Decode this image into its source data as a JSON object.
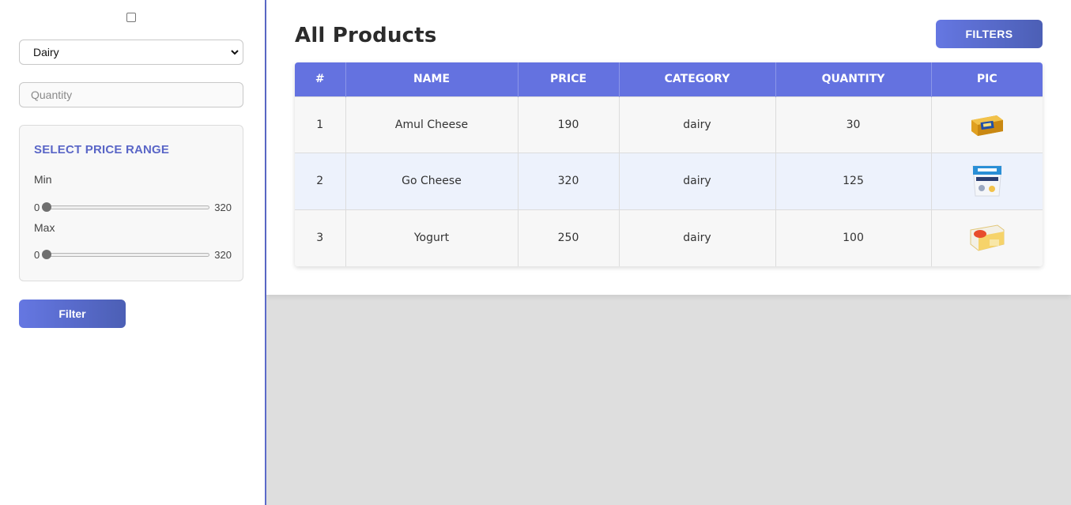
{
  "sidebar": {
    "category_select": {
      "value": "Dairy"
    },
    "quantity": {
      "placeholder": "Quantity"
    },
    "price_range": {
      "title": "SELECT PRICE RANGE",
      "min": {
        "label": "Min",
        "low": "0",
        "high": "320",
        "value": 0
      },
      "max": {
        "label": "Max",
        "low": "0",
        "high": "320",
        "value": 0
      }
    },
    "filter_button": "Filter"
  },
  "main": {
    "title": "All Products",
    "filters_button": "FILTERS",
    "table": {
      "headers": [
        "#",
        "NAME",
        "PRICE",
        "CATEGORY",
        "QUANTITY",
        "PIC"
      ],
      "rows": [
        {
          "num": "1",
          "name": "Amul Cheese",
          "price": "190",
          "category": "dairy",
          "quantity": "30",
          "pic": "cheese-box-image"
        },
        {
          "num": "2",
          "name": "Go Cheese",
          "price": "320",
          "category": "dairy",
          "quantity": "125",
          "pic": "yogurt-cup-image"
        },
        {
          "num": "3",
          "name": "Yogurt",
          "price": "250",
          "category": "dairy",
          "quantity": "100",
          "pic": "cheese-slice-pack-image"
        }
      ]
    }
  },
  "colors": {
    "accent": "#6472e0",
    "button_gradient_start": "#6577e2",
    "button_gradient_end": "#4c5fb5",
    "price_title": "#5a66c7",
    "even_row": "#edf2fc",
    "odd_row": "#f7f7f7"
  }
}
